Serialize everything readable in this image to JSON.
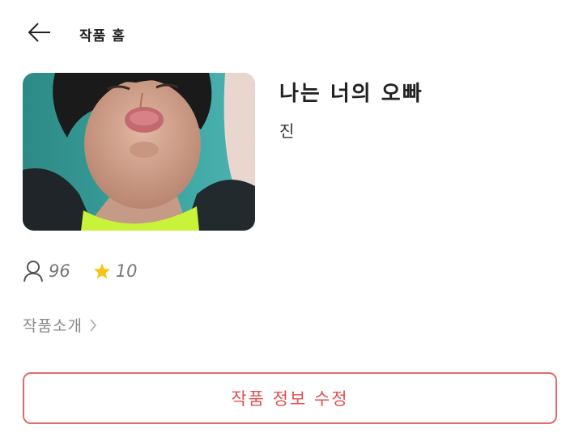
{
  "header": {
    "back_icon": "arrow-left-icon",
    "title": "작품 홈"
  },
  "work": {
    "cover_icon": "cover-image",
    "title": "나는 너의 오빠",
    "author": "진"
  },
  "stats": {
    "readers_icon": "person-icon",
    "readers": "96",
    "rating_icon": "star-icon",
    "rating": "10",
    "star_color": "#f5c518"
  },
  "intro": {
    "label": "작품소개",
    "chevron_icon": "chevron-right-icon"
  },
  "actions": {
    "edit_label": "작품 정보 수정",
    "accent_color": "#e05050"
  }
}
